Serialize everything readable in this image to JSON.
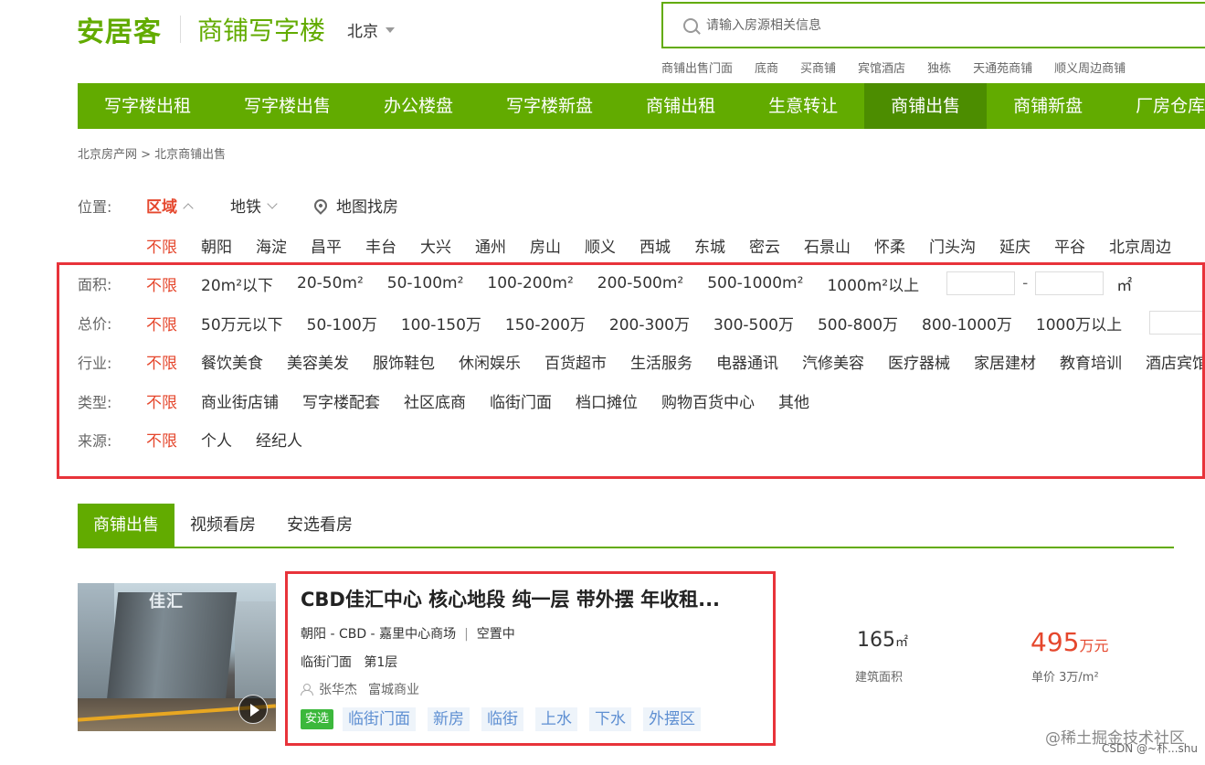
{
  "header": {
    "logo": "安居客",
    "site_name": "商铺写字楼",
    "city": "北京"
  },
  "search": {
    "placeholder": "请输入房源相关信息",
    "hot_links": [
      "商铺出售门面",
      "底商",
      "买商铺",
      "宾馆酒店",
      "独栋",
      "天通苑商铺",
      "顺义周边商铺"
    ]
  },
  "nav": {
    "items": [
      "写字楼出租",
      "写字楼出售",
      "办公楼盘",
      "写字楼新盘",
      "商铺出租",
      "生意转让",
      "商铺出售",
      "商铺新盘",
      "厂房仓库"
    ],
    "active_index": 6
  },
  "breadcrumb": "北京房产网 > 北京商铺出售",
  "filters": {
    "location": {
      "label": "位置:",
      "tabs": [
        "区域",
        "地铁",
        "地图找房"
      ],
      "districts": [
        "不限",
        "朝阳",
        "海淀",
        "昌平",
        "丰台",
        "大兴",
        "通州",
        "房山",
        "顺义",
        "西城",
        "东城",
        "密云",
        "石景山",
        "怀柔",
        "门头沟",
        "延庆",
        "平谷",
        "北京周边"
      ]
    },
    "area": {
      "label": "面积:",
      "options": [
        "不限",
        "20m²以下",
        "20-50m²",
        "50-100m²",
        "100-200m²",
        "200-500m²",
        "500-1000m²",
        "1000m²以上"
      ],
      "unit": "㎡"
    },
    "price": {
      "label": "总价:",
      "options": [
        "不限",
        "50万元以下",
        "50-100万",
        "100-150万",
        "150-200万",
        "200-300万",
        "300-500万",
        "500-800万",
        "800-1000万",
        "1000万以上"
      ]
    },
    "industry": {
      "label": "行业:",
      "options": [
        "不限",
        "餐饮美食",
        "美容美发",
        "服饰鞋包",
        "休闲娱乐",
        "百货超市",
        "生活服务",
        "电器通讯",
        "汽修美容",
        "医疗器械",
        "家居建材",
        "教育培训",
        "酒店宾馆"
      ]
    },
    "type": {
      "label": "类型:",
      "options": [
        "不限",
        "商业街店铺",
        "写字楼配套",
        "社区底商",
        "临街门面",
        "档口摊位",
        "购物百货中心",
        "其他"
      ]
    },
    "source": {
      "label": "来源:",
      "options": [
        "不限",
        "个人",
        "经纪人"
      ]
    }
  },
  "tabs": [
    "商铺出售",
    "视频看房",
    "安选看房"
  ],
  "listing": {
    "image_sign": "佳汇",
    "title": "CBD佳汇中心 核心地段 纯一层 带外摆 年收租...",
    "location": "朝阳 - CBD - 嘉里中心商场",
    "status": "空置中",
    "detail": "临街门面   第1层",
    "agent": "张华杰",
    "agent_company": "富城商业",
    "badge": "安选",
    "tags": [
      "临街门面",
      "新房",
      "临街",
      "上水",
      "下水",
      "外摆区"
    ],
    "area_value": "165",
    "area_unit": "㎡",
    "area_label": "建筑面积",
    "price_value": "495",
    "price_unit": "万元",
    "price_label": "单价 3万/m²"
  },
  "watermark": {
    "line1": "@稀土掘金技术社区",
    "line2": "CSDN @~朴...shu"
  },
  "colors": {
    "brand_green": "#62ab00",
    "active_nav": "#4c8d00",
    "selected_red": "#e5472d",
    "highlight_box": "#e8333a"
  }
}
